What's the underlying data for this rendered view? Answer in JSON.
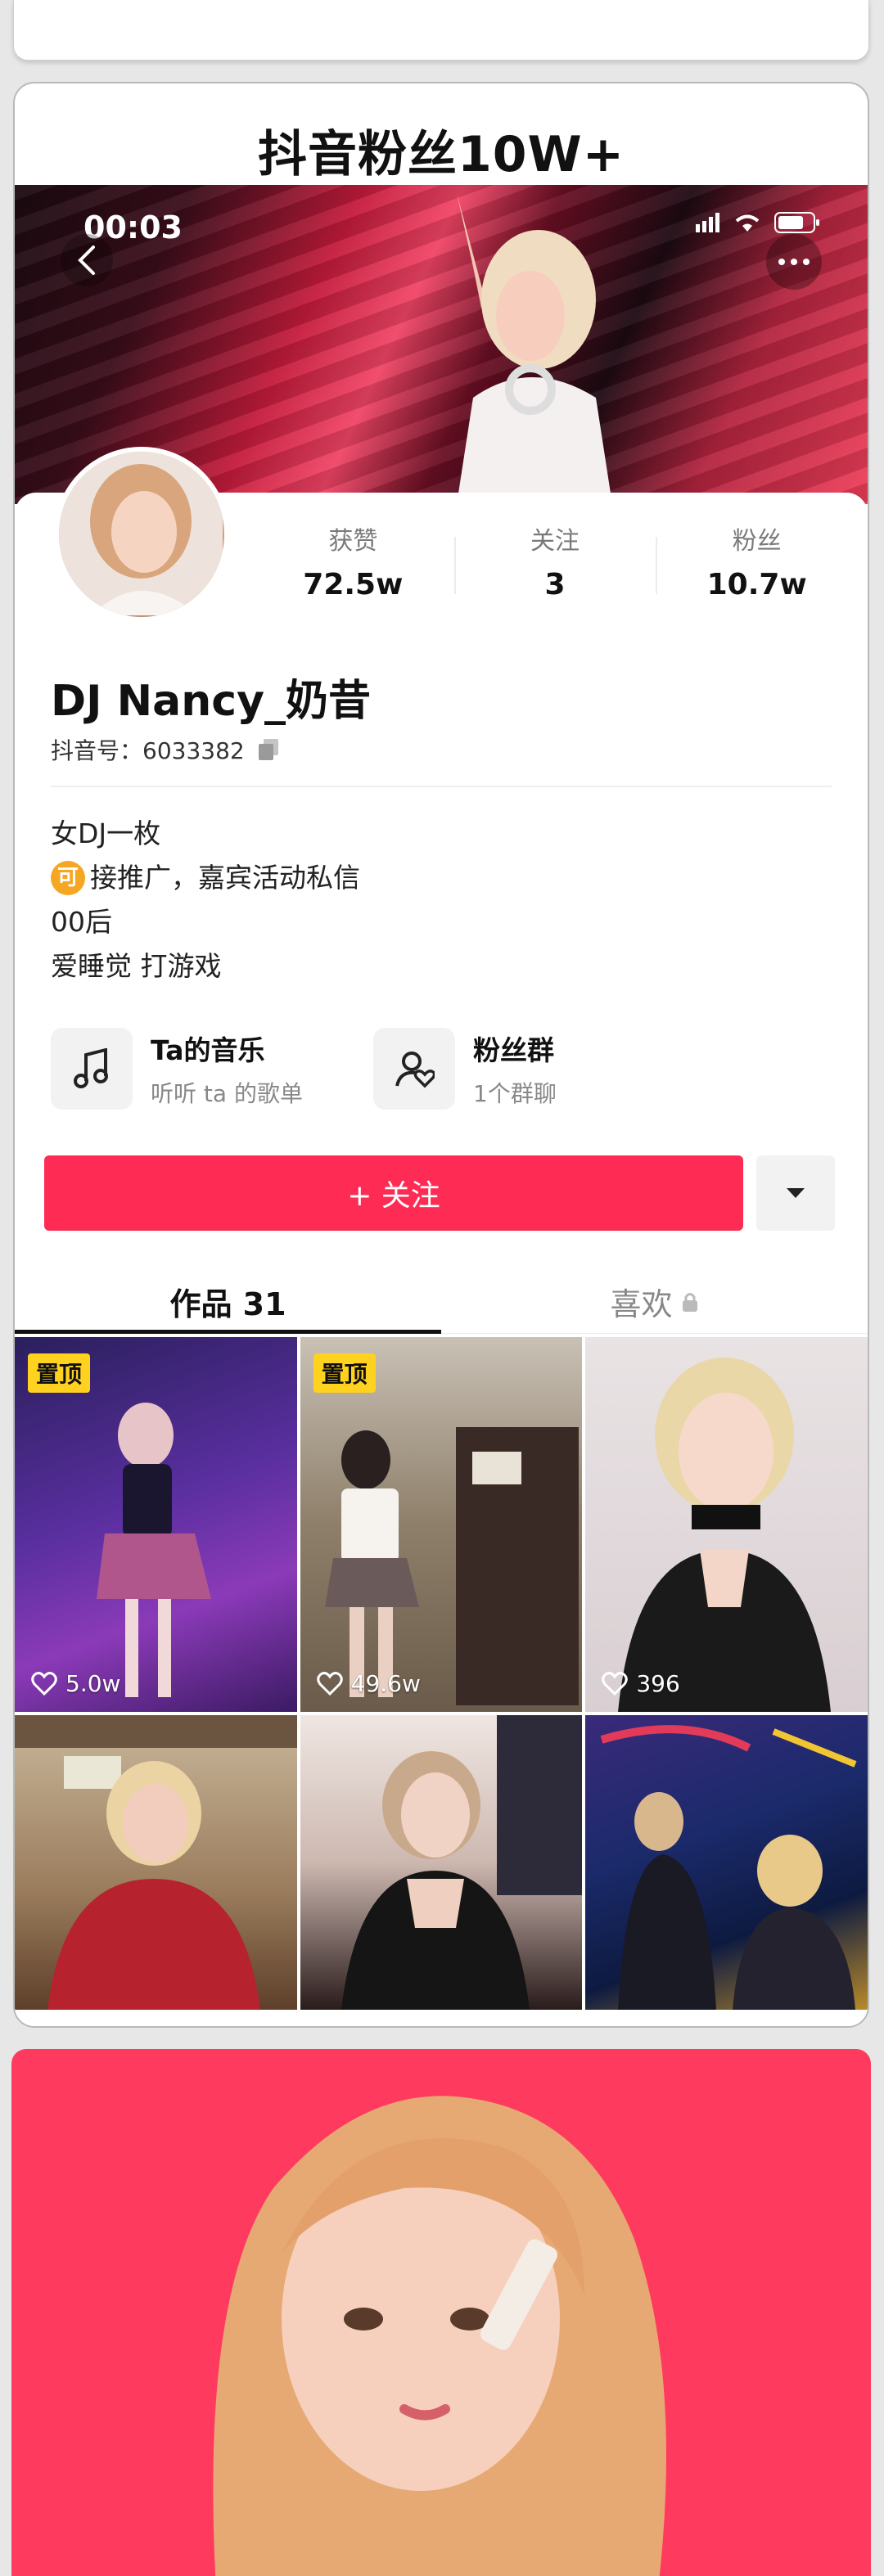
{
  "headline": "抖音粉丝10W+",
  "status": {
    "time": "00:03"
  },
  "profile": {
    "stats": [
      {
        "label": "获赞",
        "value": "72.5w"
      },
      {
        "label": "关注",
        "value": "3"
      },
      {
        "label": "粉丝",
        "value": "10.7w"
      }
    ],
    "nickname": "DJ Nancy_奶昔",
    "account": "抖音号：6033382",
    "bio": [
      "女DJ一枚",
      "接推广，嘉宾活动私信",
      "00后",
      "爱睡觉 打游戏"
    ],
    "bio_badge": "可",
    "features": [
      {
        "title": "Ta的音乐",
        "sub": "听听 ta 的歌单",
        "icon": "music-note-icon"
      },
      {
        "title": "粉丝群",
        "sub": "1个群聊",
        "icon": "fan-group-icon"
      }
    ],
    "follow_label": "+ 关注"
  },
  "tabs": [
    {
      "label": "作品 31",
      "active": true
    },
    {
      "label": "喜欢",
      "active": false,
      "locked": true
    }
  ],
  "videos": [
    {
      "pinned": "置顶",
      "likes": "5.0w"
    },
    {
      "pinned": "置顶",
      "likes": "49.6w"
    },
    {
      "pinned": "",
      "likes": "396"
    },
    {
      "pinned": "",
      "likes": ""
    },
    {
      "pinned": "",
      "likes": ""
    },
    {
      "pinned": "",
      "likes": ""
    }
  ],
  "colors": {
    "accent": "#fe2c55",
    "pin": "#ffd21f",
    "banner_bottom": "#fe3a5f"
  }
}
